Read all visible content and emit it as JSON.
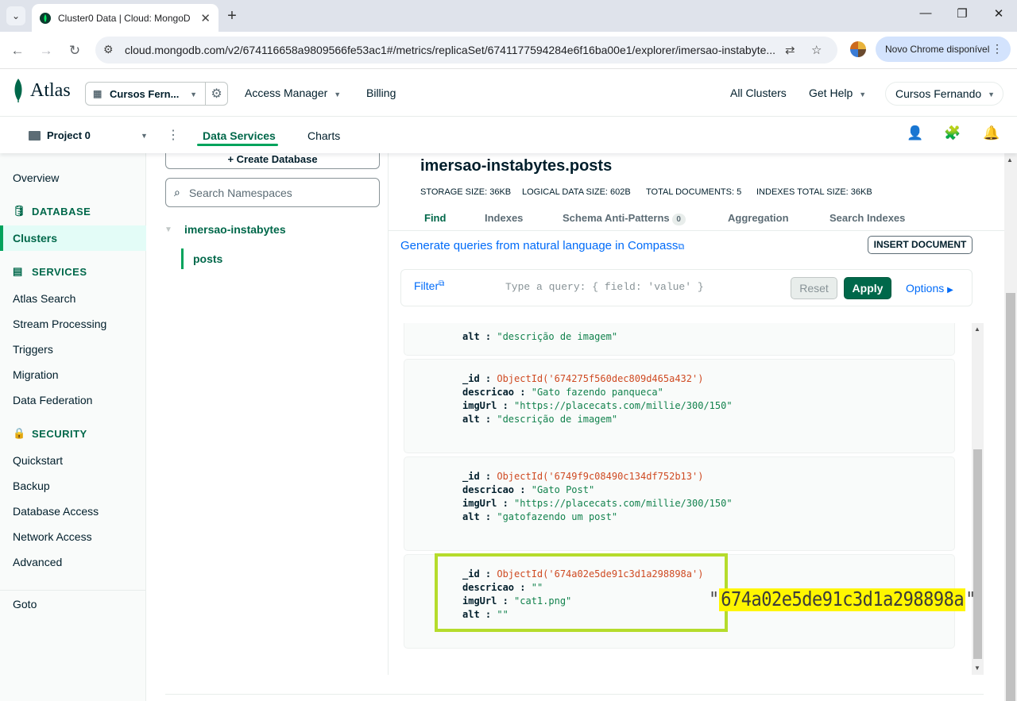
{
  "browser": {
    "tab_title": "Cluster0 Data | Cloud: MongoD",
    "url": "cloud.mongodb.com/v2/674116658a9809566fe53ac1#/metrics/replicaSet/6741177594284e6f16ba00e1/explorer/imersao-instabyte...",
    "update_label": "Novo Chrome disponível"
  },
  "header": {
    "logo": "Atlas",
    "org_name": "Cursos Fern...",
    "access_manager": "Access Manager",
    "billing": "Billing",
    "all_clusters": "All Clusters",
    "get_help": "Get Help",
    "user": "Cursos Fernando"
  },
  "subheader": {
    "project": "Project 0",
    "tab_data_services": "Data Services",
    "tab_charts": "Charts"
  },
  "sidebar": {
    "overview": "Overview",
    "database_section": "DATABASE",
    "clusters": "Clusters",
    "services_section": "SERVICES",
    "services": [
      "Atlas Search",
      "Stream Processing",
      "Triggers",
      "Migration",
      "Data Federation"
    ],
    "security_section": "SECURITY",
    "security": [
      "Quickstart",
      "Backup",
      "Database Access",
      "Network Access",
      "Advanced"
    ],
    "goto": "Goto"
  },
  "namespaces": {
    "create_db": "Create Database",
    "search_placeholder": "Search Namespaces",
    "database": "imersao-instabytes",
    "collection": "posts"
  },
  "collection": {
    "title": "imersao-instabytes.posts",
    "storage_size": "STORAGE SIZE: 36KB",
    "logical_size": "LOGICAL DATA SIZE: 602B",
    "total_docs": "TOTAL DOCUMENTS: 5",
    "indexes_size": "INDEXES TOTAL SIZE: 36KB",
    "tabs": {
      "find": "Find",
      "indexes": "Indexes",
      "schema": "Schema Anti-Patterns",
      "schema_count": "0",
      "aggregation": "Aggregation",
      "search_indexes": "Search Indexes"
    },
    "generate_link": "Generate queries from natural language in Compass",
    "insert_document": "INSERT DOCUMENT",
    "filter_label": "Filter",
    "query_placeholder": "Type a query: { field: 'value' }",
    "reset": "Reset",
    "apply": "Apply",
    "options": "Options"
  },
  "documents": [
    {
      "alt_partial_key": "alt :",
      "alt_partial_val": "\"descrição de imagem\""
    },
    {
      "id": "ObjectId('674275f560dec809d465a432')",
      "descricao": "\"Gato fazendo panqueca\"",
      "imgUrl": "\"https://placecats.com/millie/300/150\"",
      "alt": "\"descrição de imagem\""
    },
    {
      "id": "ObjectId('6749f9c08490c134df752b13')",
      "descricao": "\"Gato Post\"",
      "imgUrl": "\"https://placecats.com/millie/300/150\"",
      "alt": "\"gatofazendo um post\""
    },
    {
      "id": "ObjectId('674a02e5de91c3d1a298898a')",
      "descricao": "\"\"",
      "imgUrl": "\"cat1.png\"",
      "alt": "\"\""
    }
  ],
  "field_keys": {
    "id": "_id :",
    "descricao": "descricao :",
    "imgUrl": "imgUrl :",
    "alt": "alt :"
  },
  "zoom_callout": {
    "quote_open": "\"",
    "id_text": "674a02e5de91c3d1a298898a",
    "quote_close": "\""
  },
  "colors": {
    "accent": "#00684a",
    "highlight_box": "#b5dc2c",
    "highlight_text": "#fff600"
  }
}
